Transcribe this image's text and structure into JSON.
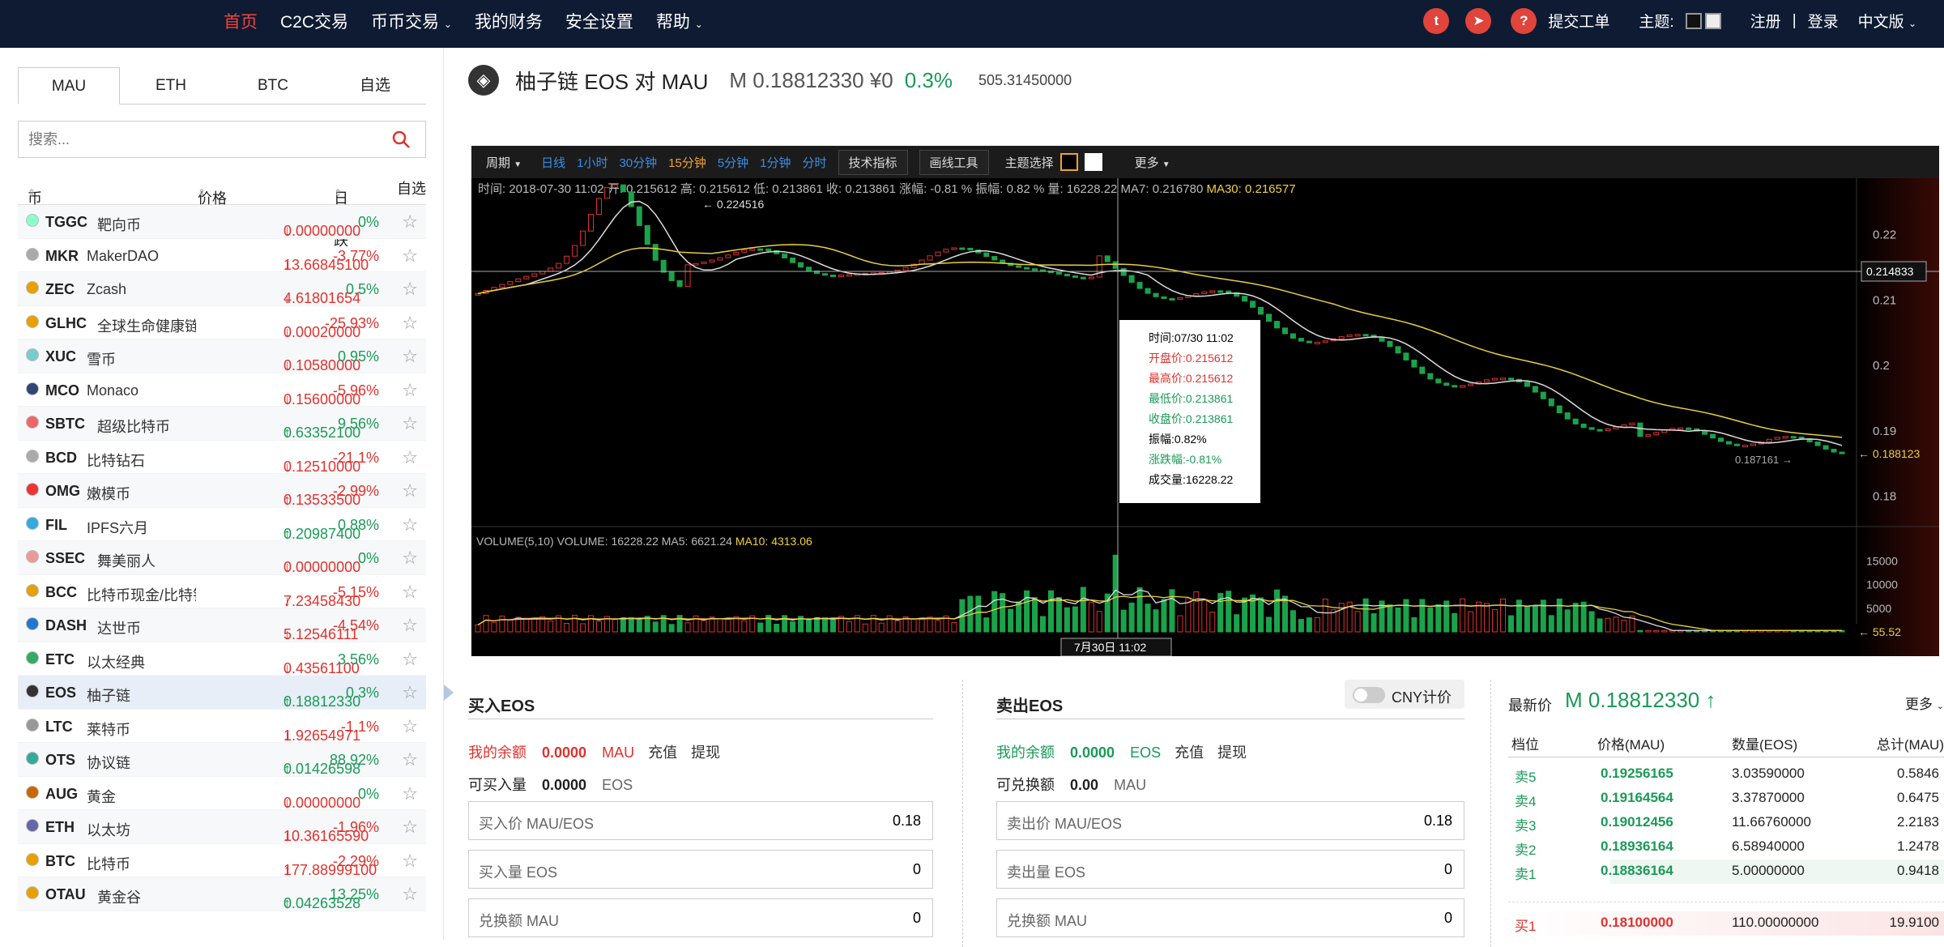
{
  "nav": {
    "home": "首页",
    "c2c": "C2C交易",
    "coin": "币币交易",
    "finance": "我的财务",
    "security": "安全设置",
    "help": "帮助",
    "ticket": "提交工单",
    "theme": "主题:",
    "register": "注册",
    "sep": "|",
    "login": "登录",
    "lang": "中文版"
  },
  "market": {
    "tabs": [
      "MAU",
      "ETH",
      "BTC",
      "自选"
    ],
    "search_placeholder": "搜索...",
    "col_coin": "币种",
    "col_price": "价格((Mau))",
    "col_change": "日涨跌",
    "col_fav": "自选",
    "rows": [
      {
        "sym": "TGGC",
        "name": "靶向币",
        "price": "0.00000000",
        "chg": "0%",
        "dir": "down"
      },
      {
        "sym": "MKR",
        "name": "MakerDAO",
        "price": "13.66845100",
        "chg": "-3.77%",
        "dir": "down"
      },
      {
        "sym": "ZEC",
        "name": "Zcash",
        "price": "4.61801654",
        "chg": "0.5%",
        "dir": "down"
      },
      {
        "sym": "GLHC",
        "name": "全球生命健康链",
        "price": "0.00020000",
        "chg": "-25.93%",
        "dir": "down"
      },
      {
        "sym": "XUC",
        "name": "雪币",
        "price": "0.10580000",
        "chg": "0.95%",
        "dir": "down"
      },
      {
        "sym": "MCO",
        "name": "Monaco",
        "price": "0.15600000",
        "chg": "-5.96%",
        "dir": "down"
      },
      {
        "sym": "SBTC",
        "name": "超级比特币",
        "price": "0.63352100",
        "chg": "9.56%",
        "dir": "up"
      },
      {
        "sym": "BCD",
        "name": "比特钻石",
        "price": "0.12510000",
        "chg": "-21.1%",
        "dir": "down"
      },
      {
        "sym": "OMG",
        "name": "嫩模币",
        "price": "0.13533500",
        "chg": "-2.99%",
        "dir": "up"
      },
      {
        "sym": "FIL",
        "name": "IPFS六月",
        "price": "0.20987400",
        "chg": "0.88%",
        "dir": "up"
      },
      {
        "sym": "SSEC",
        "name": "舞美丽人",
        "price": "0.00000000",
        "chg": "0%",
        "dir": "down"
      },
      {
        "sym": "BCC",
        "name": "比特币现金/比特钞",
        "price": "7.23458430",
        "chg": "-5.15%",
        "dir": "down"
      },
      {
        "sym": "DASH",
        "name": "达世币",
        "price": "5.12546111",
        "chg": "-4.54%",
        "dir": "down"
      },
      {
        "sym": "ETC",
        "name": "以太经典",
        "price": "0.43561100",
        "chg": "3.56%",
        "dir": "down"
      },
      {
        "sym": "EOS",
        "name": "柚子链",
        "price": "0.18812330",
        "chg": "0.3%",
        "dir": "up"
      },
      {
        "sym": "LTC",
        "name": "莱特币",
        "price": "1.92654971",
        "chg": "-1.1%",
        "dir": "down"
      },
      {
        "sym": "OTS",
        "name": "协议链",
        "price": "0.01426598",
        "chg": "88.92%",
        "dir": "up"
      },
      {
        "sym": "AUG",
        "name": "黄金",
        "price": "0.00000000",
        "chg": "0%",
        "dir": "down"
      },
      {
        "sym": "ETH",
        "name": "以太坊",
        "price": "10.36165590",
        "chg": "-1.96%",
        "dir": "down"
      },
      {
        "sym": "BTC",
        "name": "比特币",
        "price": "177.88999100",
        "chg": "-2.29%",
        "dir": "up"
      },
      {
        "sym": "OTAU",
        "name": "黄金谷",
        "price": "0.04263528",
        "chg": "13.25%",
        "dir": "up"
      }
    ]
  },
  "ticker": {
    "pair": "柚子链 EOS 对 MAU",
    "price": "M 0.18812330 ¥0",
    "change": "0.3%",
    "volume": "505.31450000"
  },
  "chart": {
    "toolbar": {
      "period": "周期",
      "day": "日线",
      "h1": "1小时",
      "m30": "30分钟",
      "m15": "15分钟",
      "m5": "5分钟",
      "m1": "1分钟",
      "tick": "分时",
      "indicators": "技术指标",
      "draw": "画线工具",
      "theme": "主题选择",
      "more": "更多"
    },
    "info_line": "时间: 2018-07-30 11:02 开: 0.215612 高: 0.215612 低: 0.213861 收: 0.213861 涨幅: -0.81 % 振幅: 0.82 % 量: 16228.22 MA7: 0.216780",
    "ma30": "MA30: 0.216577",
    "tooltip": {
      "time": "时间:07/30 11:02",
      "open": "开盘价:0.215612",
      "high": "最高价:0.215612",
      "low": "最低价:0.213861",
      "close": "收盘价:0.213861",
      "amp": "振幅:0.82%",
      "chg": "涨跌幅:-0.81%",
      "vol": "成交量:16228.22"
    },
    "vol_line": "VOLUME(5,10) VOLUME: 16228.22 MA5: 6621.24",
    "ma10": "MA10: 4313.06",
    "peak_label": "0.224516",
    "low_label": "0.187161",
    "cross_label": "0.214833",
    "last_label": "0.188123",
    "vol_last": "55.52",
    "time_label": "7月30日 11:02",
    "price_ticks": [
      "0.22",
      "0.21",
      "0.2",
      "0.19",
      "0.18"
    ],
    "vol_ticks": [
      "15000",
      "10000",
      "5000"
    ]
  },
  "chart_data": {
    "type": "candlestick",
    "ylim": [
      0.176,
      0.228
    ],
    "price_ticks": [
      0.22,
      0.21,
      0.2,
      0.19,
      0.18
    ],
    "peak": 0.224516,
    "low": 0.187161,
    "last": 0.188123,
    "crosshair": 0.214833,
    "volume_ticks": [
      15000,
      10000,
      5000
    ]
  },
  "buy": {
    "title": "买入EOS",
    "balance_label": "我的余额",
    "balance": "0.0000",
    "unit": "MAU",
    "deposit": "充值",
    "withdraw": "提现",
    "avail_label": "可买入量",
    "avail": "0.0000",
    "avail_unit": "EOS",
    "price_label": "买入价 MAU/EOS",
    "price": "0.18",
    "amount_label": "买入量 EOS",
    "amount": "0",
    "total_label": "兑换额 MAU",
    "total": "0"
  },
  "sell": {
    "title": "卖出EOS",
    "cny": "CNY计价",
    "balance_label": "我的余额",
    "balance": "0.0000",
    "unit": "EOS",
    "deposit": "充值",
    "withdraw": "提现",
    "avail_label": "可兑换额",
    "avail": "0.00",
    "avail_unit": "MAU",
    "price_label": "卖出价 MAU/EOS",
    "price": "0.18",
    "amount_label": "卖出量 EOS",
    "amount": "0",
    "total_label": "兑换额 MAU",
    "total": "0"
  },
  "orderbook": {
    "latest_label": "最新价",
    "latest": "M 0.18812330",
    "more": "更多",
    "cols": [
      "档位",
      "价格(MAU)",
      "数量(EOS)",
      "总计(MAU)"
    ],
    "asks": [
      {
        "lvl": "卖5",
        "p": "0.19256165",
        "q": "3.03590000",
        "t": "0.5846"
      },
      {
        "lvl": "卖4",
        "p": "0.19164564",
        "q": "3.37870000",
        "t": "0.6475"
      },
      {
        "lvl": "卖3",
        "p": "0.19012456",
        "q": "11.66760000",
        "t": "2.2183"
      },
      {
        "lvl": "卖2",
        "p": "0.18936164",
        "q": "6.58940000",
        "t": "1.2478"
      },
      {
        "lvl": "卖1",
        "p": "0.18836164",
        "q": "5.00000000",
        "t": "0.9418"
      }
    ],
    "bids": [
      {
        "lvl": "买1",
        "p": "0.18100000",
        "q": "110.00000000",
        "t": "19.9100"
      }
    ]
  }
}
